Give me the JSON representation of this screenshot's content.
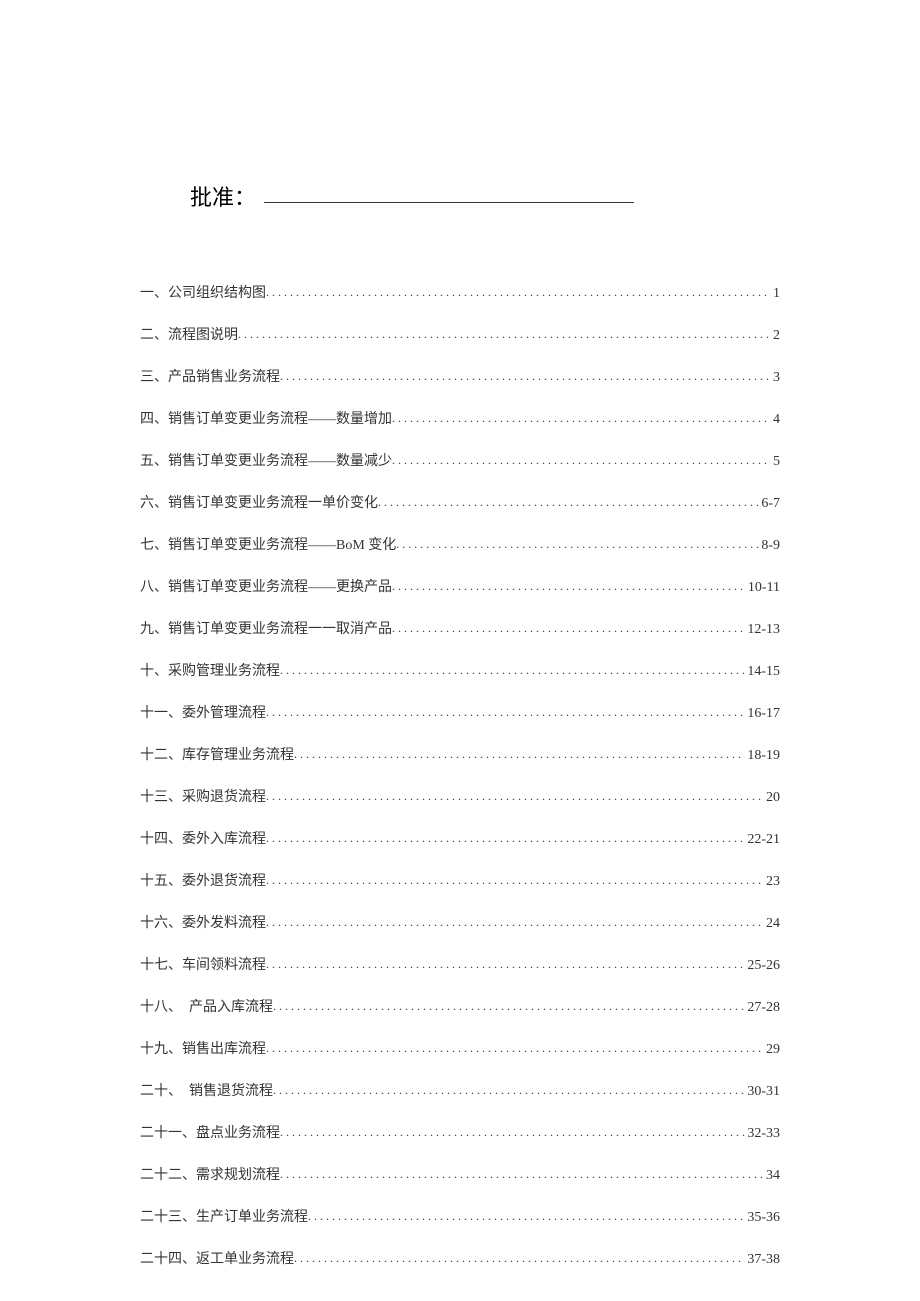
{
  "approval_label": "批准：",
  "toc": [
    {
      "title": "一、公司组织结构图",
      "page": "1"
    },
    {
      "title": "二、流程图说明",
      "page": "2"
    },
    {
      "title": "三、产品销售业务流程",
      "page": "3"
    },
    {
      "title": "四、销售订单变更业务流程——数量增加 ",
      "page": "4"
    },
    {
      "title": "五、销售订单变更业务流程——数量减少",
      "page": "5"
    },
    {
      "title": "六、销售订单变更业务流程一单价变化 ",
      "page": "6-7"
    },
    {
      "title": "七、销售订单变更业务流程——BoM 变化 ",
      "page": "8-9"
    },
    {
      "title": "八、销售订单变更业务流程——更换产品 ",
      "page": "10-11"
    },
    {
      "title": "九、销售订单变更业务流程一一取消产品 ",
      "page": "12-13"
    },
    {
      "title": "十、采购管理业务流程 ",
      "page": "14-15"
    },
    {
      "title": "十一、委外管理流程 ",
      "page": "16-17"
    },
    {
      "title": "十二、库存管理业务流程 ",
      "page": "18-19"
    },
    {
      "title": "十三、采购退货流程 ",
      "page": "20"
    },
    {
      "title": "十四、委外入库流程 ",
      "page": "22-21"
    },
    {
      "title": "十五、委外退货流程",
      "page": "23"
    },
    {
      "title": "十六、委外发料流程",
      "page": "24"
    },
    {
      "title": "十七、车间领料流程 ",
      "page": "25-26"
    },
    {
      "title": "十八、　产品入库流程",
      "page": "27-28"
    },
    {
      "title": "十九、销售出库流程 ",
      "page": "29"
    },
    {
      "title": "二十、　销售退货流程",
      "page": "30-31"
    },
    {
      "title": "二十一、盘点业务流程 ",
      "page": "32-33"
    },
    {
      "title": "二十二、需求规划流程 ",
      "page": "34"
    },
    {
      "title": "二十三、生产订单业务流程 ",
      "page": "35-36"
    },
    {
      "title": "二十四、返工单业务流程 ",
      "page": "37-38"
    }
  ]
}
